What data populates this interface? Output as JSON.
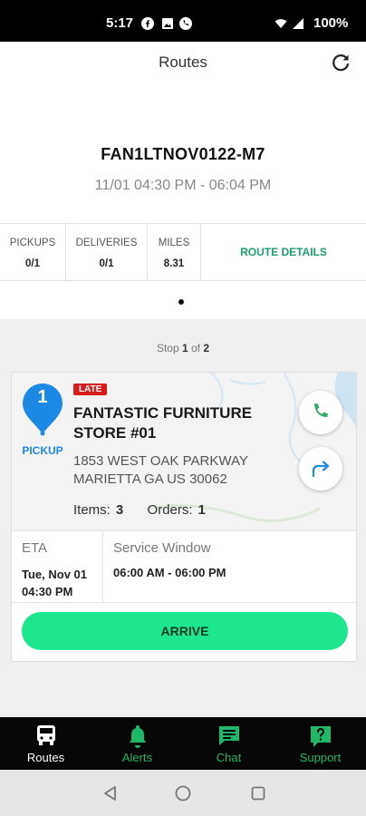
{
  "status_bar": {
    "time": "5:17",
    "battery": "100%",
    "icons": [
      "facebook-icon",
      "gallery-icon",
      "phone-icon",
      "wifi-icon",
      "signal-icon",
      "battery-icon"
    ]
  },
  "header": {
    "title": "Routes",
    "refresh_icon": "refresh-icon"
  },
  "route": {
    "id": "FAN1LTNOV0122-M7",
    "time_range": "11/01 04:30 PM - 06:04 PM"
  },
  "stats": {
    "pickups_label": "PICKUPS",
    "pickups_value": "0/1",
    "deliveries_label": "DELIVERIES",
    "deliveries_value": "0/1",
    "miles_label": "MILES",
    "miles_value": "8.31",
    "route_details_label": "ROUTE DETAILS"
  },
  "stop_indicator": {
    "prefix": "Stop",
    "current": "1",
    "middle": "of",
    "total": "2"
  },
  "stop": {
    "number": "1",
    "type_label": "PICKUP",
    "badge": "LATE",
    "name": "FANTASTIC FURNITURE STORE #01",
    "address_line1": "1853 WEST OAK PARKWAY",
    "address_line2": "MARIETTA GA US 30062",
    "items_label": "Items:",
    "items_value": "3",
    "orders_label": "Orders:",
    "orders_value": "1",
    "eta_label": "ETA",
    "eta_date": "Tue, Nov 01",
    "eta_time": "04:30 PM",
    "service_window_label": "Service Window",
    "service_window_value": "06:00 AM - 06:00 PM",
    "arrive_label": "ARRIVE"
  },
  "bottom_nav": {
    "items": [
      {
        "label": "Routes",
        "icon": "truck-icon",
        "active": true
      },
      {
        "label": "Alerts",
        "icon": "bell-icon",
        "active": false
      },
      {
        "label": "Chat",
        "icon": "chat-icon",
        "active": false
      },
      {
        "label": "Support",
        "icon": "help-icon",
        "active": false
      }
    ]
  },
  "colors": {
    "accent_green": "#1ee68e",
    "link_green": "#1aa06d",
    "late_red": "#d81b1b",
    "pickup_blue": "#1e88e5"
  }
}
